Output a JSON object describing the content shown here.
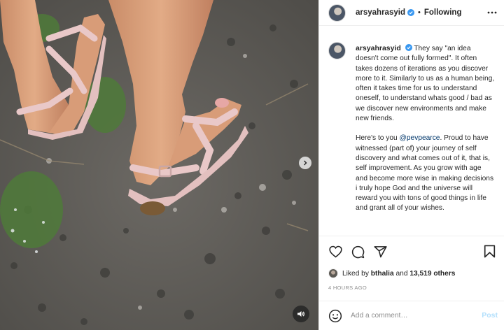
{
  "post": {
    "username": "arsyahrasyid",
    "separator": "•",
    "follow_status": "Following",
    "caption_paragraphs": [
      "They say \"an idea doesn't come out fully formed\". It often takes dozens of iterations as you discover more to it. Similarly to us as a human being, often it takes time for us to understand oneself, to understand whats good / bad as we discover new environments and make new friends."
    ],
    "caption_p2_before": "Here's to you ",
    "caption_p2_mention": "@pevpearce",
    "caption_p2_after": ". Proud to have witnessed (part of) your journey of self discovery and what comes out of it, that is, self improvement. As you grow with age and become more wise in making decisions i truly hope God and the universe will reward you with tons of good things in life and grant all of your wishes.",
    "likes_prefix": "Liked by ",
    "likes_user": "bthalia",
    "likes_middle": " and ",
    "likes_count": "13,519 others",
    "timestamp": "4 HOURS AGO"
  },
  "comment_form": {
    "placeholder": "Add a comment…",
    "post_label": "Post"
  },
  "icons": {
    "more": "more-options-icon",
    "verified": "verified-badge-icon",
    "like": "heart-icon",
    "comment": "comment-bubble-icon",
    "share": "paper-plane-icon",
    "save": "bookmark-icon",
    "emoji": "smiley-icon",
    "sound": "speaker-icon",
    "next": "chevron-right-icon"
  },
  "colors": {
    "verified_blue": "#3897f0",
    "post_button_disabled": "#b2dffc",
    "link": "#00376b",
    "muted": "#8e8e8e"
  }
}
